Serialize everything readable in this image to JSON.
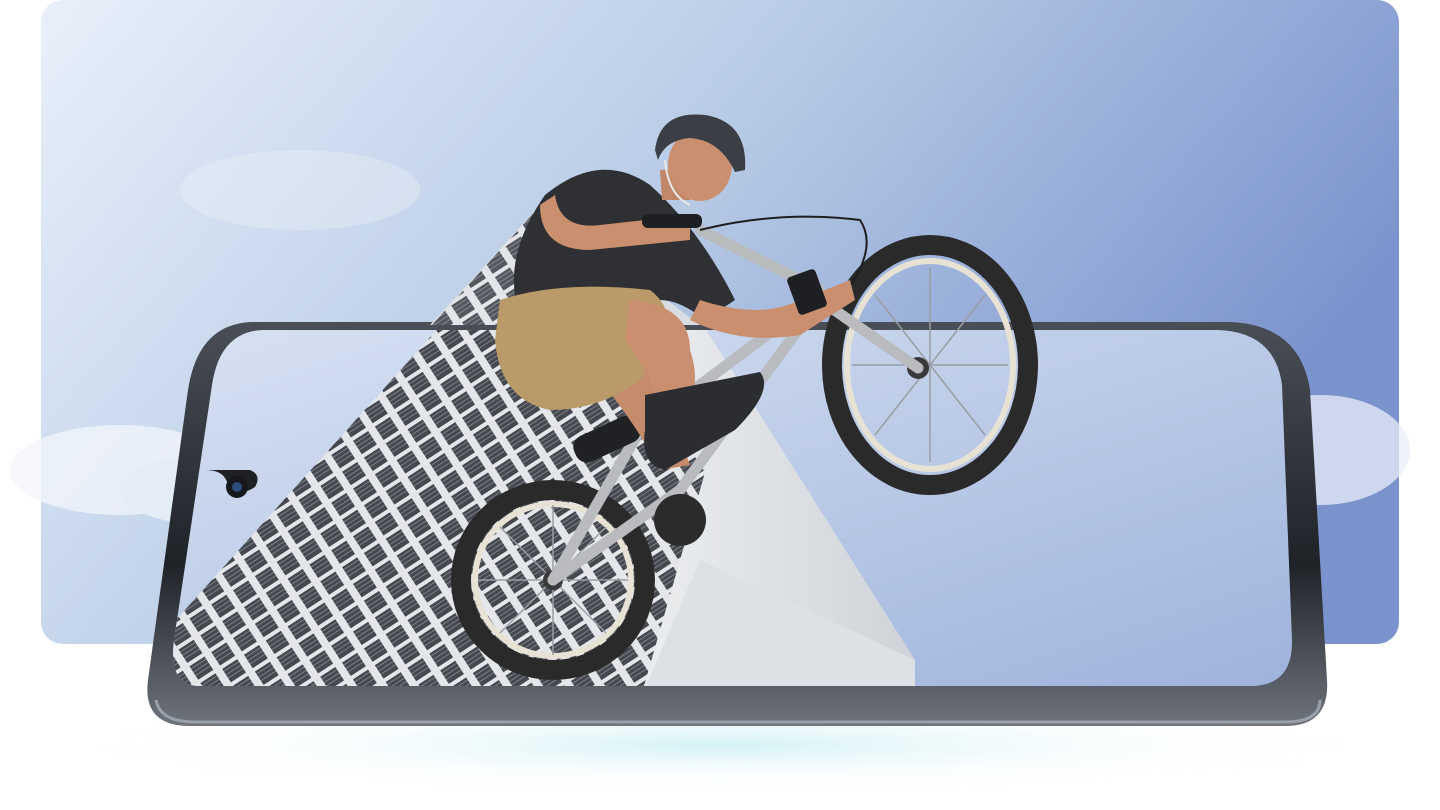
{
  "scene": {
    "subject": "bmx-rider-jumping-out-of-phone-screen",
    "colors": {
      "sky_light": "#e6eef8",
      "sky_mid": "#b9cce6",
      "sky_deep": "#7f97cf",
      "phone_frame": "#2a2d33",
      "phone_edge": "#8a8f99",
      "screen_sky_top": "#c9d6ec",
      "screen_sky_bottom": "#9fb4dd",
      "building_wall": "#e9ecef",
      "building_vent_dark": "#3a3d42",
      "shirt": "#2e3034",
      "shorts": "#b99a68",
      "skin": "#c98f6f",
      "helmet": "#3b3e44",
      "tire": "#2a2a2a",
      "rim": "#e8e2d4",
      "frame_metal": "#b9bbbf",
      "glow": "#cfeef2"
    },
    "icons": {
      "camera": "front-camera-notch-icon"
    }
  }
}
